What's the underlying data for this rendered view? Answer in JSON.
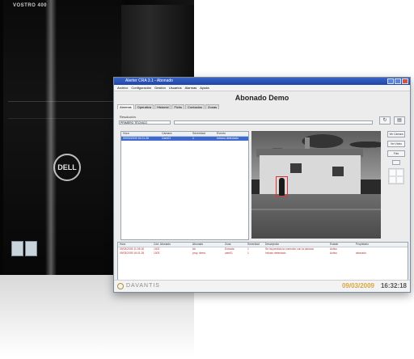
{
  "computer": {
    "brand_text": "VOSTRO 400",
    "logo": "DELL"
  },
  "window": {
    "title": "Alerter CRA 3.1 - Abonado",
    "menu": [
      "Archivo",
      "Configuración",
      "Gestión",
      "Usuarios",
      "Alarmas",
      "Ayuda"
    ],
    "page_title": "Abonado Demo",
    "tabs": [
      "Alarmas",
      "Operativa",
      "Historial",
      "Fichs",
      "Contactos",
      "Zonas"
    ],
    "filter_label": "Resolución",
    "filter_value": "PRIMERO TÉCNICO",
    "alarm_table": {
      "columns": [
        "Hora",
        "Cámara",
        "Severidad",
        "Evento"
      ],
      "rows": [
        [
          "09/03/2009 16:01:26",
          "Cam01",
          "1",
          "Intruso detectado"
        ]
      ]
    },
    "side_buttons": [
      "Ver Cámara",
      "Ver Vídeo",
      "Foto"
    ],
    "events": {
      "columns": [
        "Hora",
        "Cód. Abonado",
        "Abonado",
        "Zona",
        "Severidad",
        "Descripción",
        "Estado",
        "Propietario"
      ],
      "rows": [
        [
          "09/03/2009 11:05:18",
          "1002",
          "Ab",
          "Entrada",
          "1",
          "Se ha perdido la conexión con la cámara",
          "Activo",
          ""
        ],
        [
          "09/03/2009 16:01:26",
          "1003",
          "proy. demo",
          "cam01",
          "1",
          "Intruso detectado",
          "Activo",
          "abonado"
        ]
      ]
    },
    "status": {
      "brand": "DAVANTIS",
      "date": "09/03/2009",
      "time": "16:32:18"
    }
  }
}
